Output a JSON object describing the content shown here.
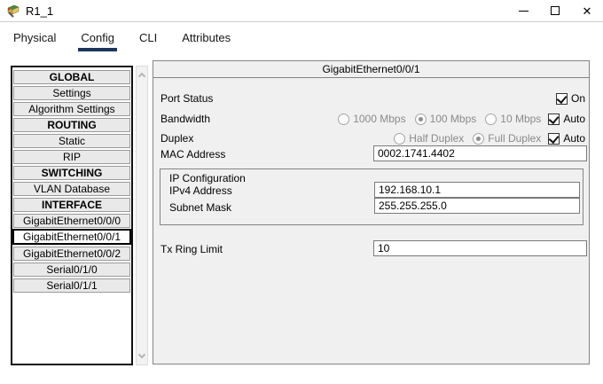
{
  "window": {
    "title": "R1_1"
  },
  "tabs": [
    {
      "label": "Physical",
      "active": false
    },
    {
      "label": "Config",
      "active": true
    },
    {
      "label": "CLI",
      "active": false
    },
    {
      "label": "Attributes",
      "active": false
    }
  ],
  "sidebar": {
    "items": [
      {
        "label": "GLOBAL",
        "type": "header"
      },
      {
        "label": "Settings",
        "type": "item"
      },
      {
        "label": "Algorithm Settings",
        "type": "item"
      },
      {
        "label": "ROUTING",
        "type": "header"
      },
      {
        "label": "Static",
        "type": "item"
      },
      {
        "label": "RIP",
        "type": "item"
      },
      {
        "label": "SWITCHING",
        "type": "header"
      },
      {
        "label": "VLAN Database",
        "type": "item"
      },
      {
        "label": "INTERFACE",
        "type": "header"
      },
      {
        "label": "GigabitEthernet0/0/0",
        "type": "item"
      },
      {
        "label": "GigabitEthernet0/0/1",
        "type": "item",
        "selected": true
      },
      {
        "label": "GigabitEthernet0/0/2",
        "type": "item"
      },
      {
        "label": "Serial0/1/0",
        "type": "item"
      },
      {
        "label": "Serial0/1/1",
        "type": "item"
      }
    ]
  },
  "panel": {
    "header": "GigabitEthernet0/0/1",
    "port_status": {
      "label": "Port Status",
      "on_label": "On",
      "checked": true
    },
    "bandwidth": {
      "label": "Bandwidth",
      "options": [
        {
          "label": "1000 Mbps",
          "selected": false
        },
        {
          "label": "100 Mbps",
          "selected": true
        },
        {
          "label": "10 Mbps",
          "selected": false
        }
      ],
      "auto_label": "Auto",
      "auto_checked": true
    },
    "duplex": {
      "label": "Duplex",
      "options": [
        {
          "label": "Half Duplex",
          "selected": false
        },
        {
          "label": "Full Duplex",
          "selected": true
        }
      ],
      "auto_label": "Auto",
      "auto_checked": true
    },
    "mac": {
      "label": "MAC Address",
      "value": "0002.1741.4402"
    },
    "ip_config": {
      "title": "IP Configuration",
      "ipv4": {
        "label": "IPv4 Address",
        "value": "192.168.10.1"
      },
      "subnet": {
        "label": "Subnet Mask",
        "value": "255.255.255.0"
      }
    },
    "tx_ring": {
      "label": "Tx Ring Limit",
      "value": "10"
    }
  },
  "icons": {
    "close_glyph": "✕"
  },
  "colors": {
    "accent_tab": "#1c355c",
    "panel_bg": "#f0f0f0"
  }
}
